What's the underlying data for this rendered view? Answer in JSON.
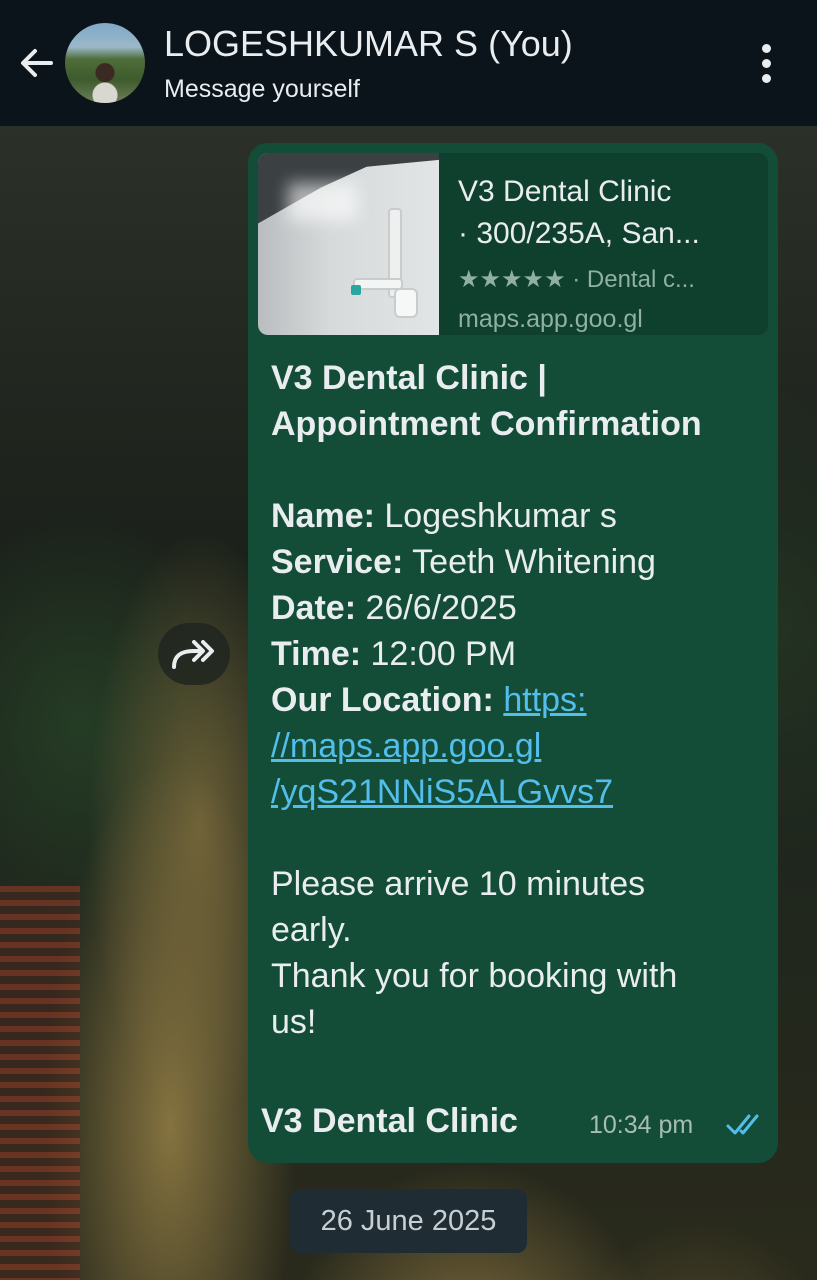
{
  "header": {
    "contact_name": "LOGESHKUMAR S (You)",
    "status": "Message yourself",
    "back_icon": "arrow-left-icon",
    "menu_icon": "more-vertical-icon"
  },
  "message": {
    "preview": {
      "title_line1": "V3 Dental Clinic",
      "title_line2": "· 300/235A, San...",
      "rating_text": "★★★★★ · Dental c...",
      "url": "maps.app.goo.gl"
    },
    "heading_line1": "V3 Dental Clinic |",
    "heading_line2": "Appointment Confirmation",
    "fields": {
      "name_label": "Name:",
      "name_value": " Logeshkumar s",
      "service_label": "Service:",
      "service_value": " Teeth Whitening",
      "date_label": "Date:",
      "date_value": " 26/6/2025",
      "time_label": "Time:",
      "time_value": " 12:00 PM",
      "location_label": "Our Location:",
      "location_link_line1": "https:",
      "location_link_line2": "//maps.app.goo.gl",
      "location_link_line3": "/yqS21NNiS5ALGvvs7"
    },
    "note_line1": "Please arrive 10 minutes",
    "note_line2": "early.",
    "note_line3": "Thank you for booking with",
    "note_line4": "us!",
    "signature": "V3 Dental Clinic",
    "timestamp": "10:34 pm",
    "read_status_icon": "double-check-icon",
    "read_color": "#53bdeb"
  },
  "forward_icon": "forward-icon",
  "date_chip": "26 June 2025",
  "colors": {
    "header_bg": "#0b141a",
    "bubble_bg": "#134d37",
    "link": "#53bdeb"
  }
}
